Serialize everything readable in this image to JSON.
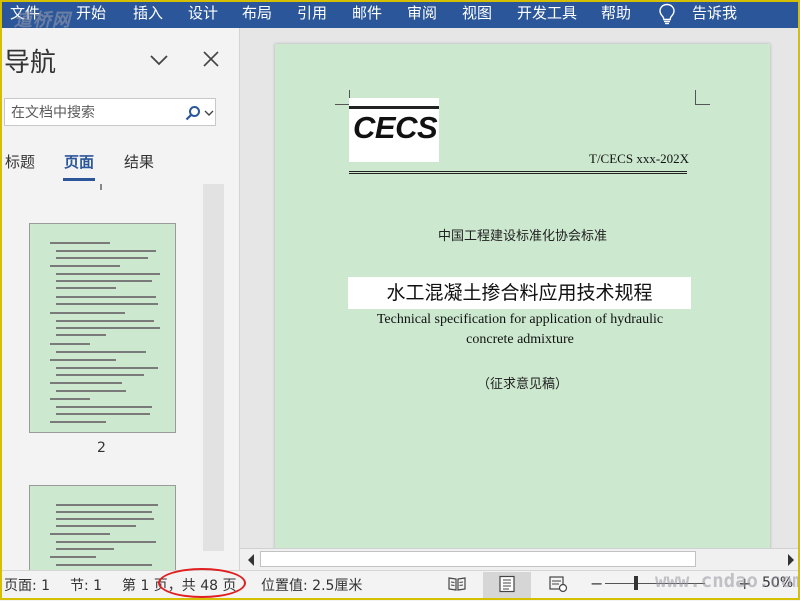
{
  "ribbon": {
    "tabs": [
      "文件",
      "开始",
      "插入",
      "设计",
      "布局",
      "引用",
      "邮件",
      "审阅",
      "视图",
      "开发工具",
      "帮助"
    ],
    "tell_me": "告诉我",
    "background": "#2b579a",
    "tell_me_icon": "lightbulb-icon"
  },
  "nav_pane": {
    "title": "导航",
    "search_placeholder": "在文档中搜索",
    "tabs": [
      "标题",
      "页面",
      "结果"
    ],
    "active_tab": "页面",
    "thumbnails": [
      {
        "label": "2"
      },
      {
        "label": ""
      }
    ]
  },
  "document": {
    "logo_text": "CECS",
    "standard_code": "T/CECS xxx-202X",
    "association": "中国工程建设标准化协会标准",
    "title_cn": "水工混凝土掺合料应用技术规程",
    "title_en": "Technical specification for application of hydraulic concrete admixture",
    "draft_label": "（征求意见稿）",
    "page_color": "#cce8cf"
  },
  "status_bar": {
    "page": "页面: 1",
    "section": "节: 1",
    "page_count": "第 1 页，共 48 页",
    "position": "位置值: 2.5厘米",
    "zoom": "50%",
    "views": [
      "read-mode-icon",
      "print-layout-icon",
      "web-layout-icon"
    ]
  },
  "watermarks": {
    "top_left": "道桥网",
    "bottom_right": "www.cndao.com"
  },
  "annotation_color": "#e02020"
}
